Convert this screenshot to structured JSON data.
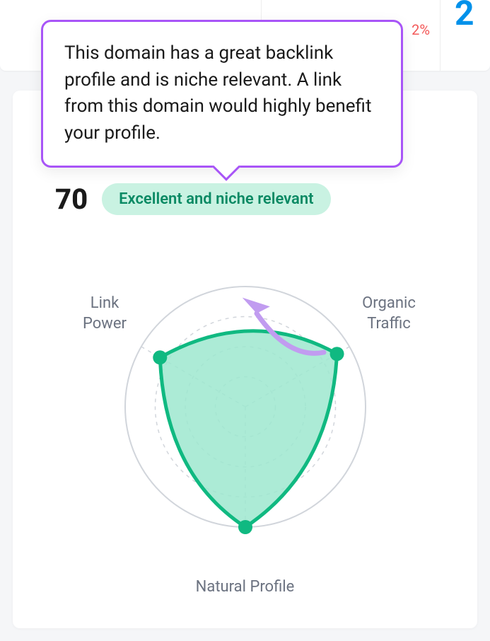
{
  "top_section": {
    "percent_change": "2%",
    "partial_number": "2"
  },
  "tooltip": {
    "text": "This domain has a great backlink profile and is niche relevant. A link from this domain would highly benefit your profile."
  },
  "score": {
    "value": "70",
    "badge_label": "Excellent and niche relevant"
  },
  "chart_labels": {
    "link_power": "Link Power",
    "organic_traffic": "Organic Traffic",
    "natural_profile": "Natural Profile"
  },
  "colors": {
    "accent_purple": "#a855f7",
    "badge_bg": "#c9f2e2",
    "badge_text": "#0a8a64",
    "chart_fill": "#9de8cf",
    "chart_stroke": "#10b981",
    "negative": "#F35A5A",
    "blue": "#0091ea"
  },
  "chart_data": {
    "type": "radar",
    "title": "",
    "categories": [
      "Link Power",
      "Organic Traffic",
      "Natural Profile"
    ],
    "values": [
      82,
      88,
      100
    ],
    "max": 100,
    "rings": 4,
    "fill_color": "#9de8cf",
    "stroke_color": "#10b981"
  }
}
